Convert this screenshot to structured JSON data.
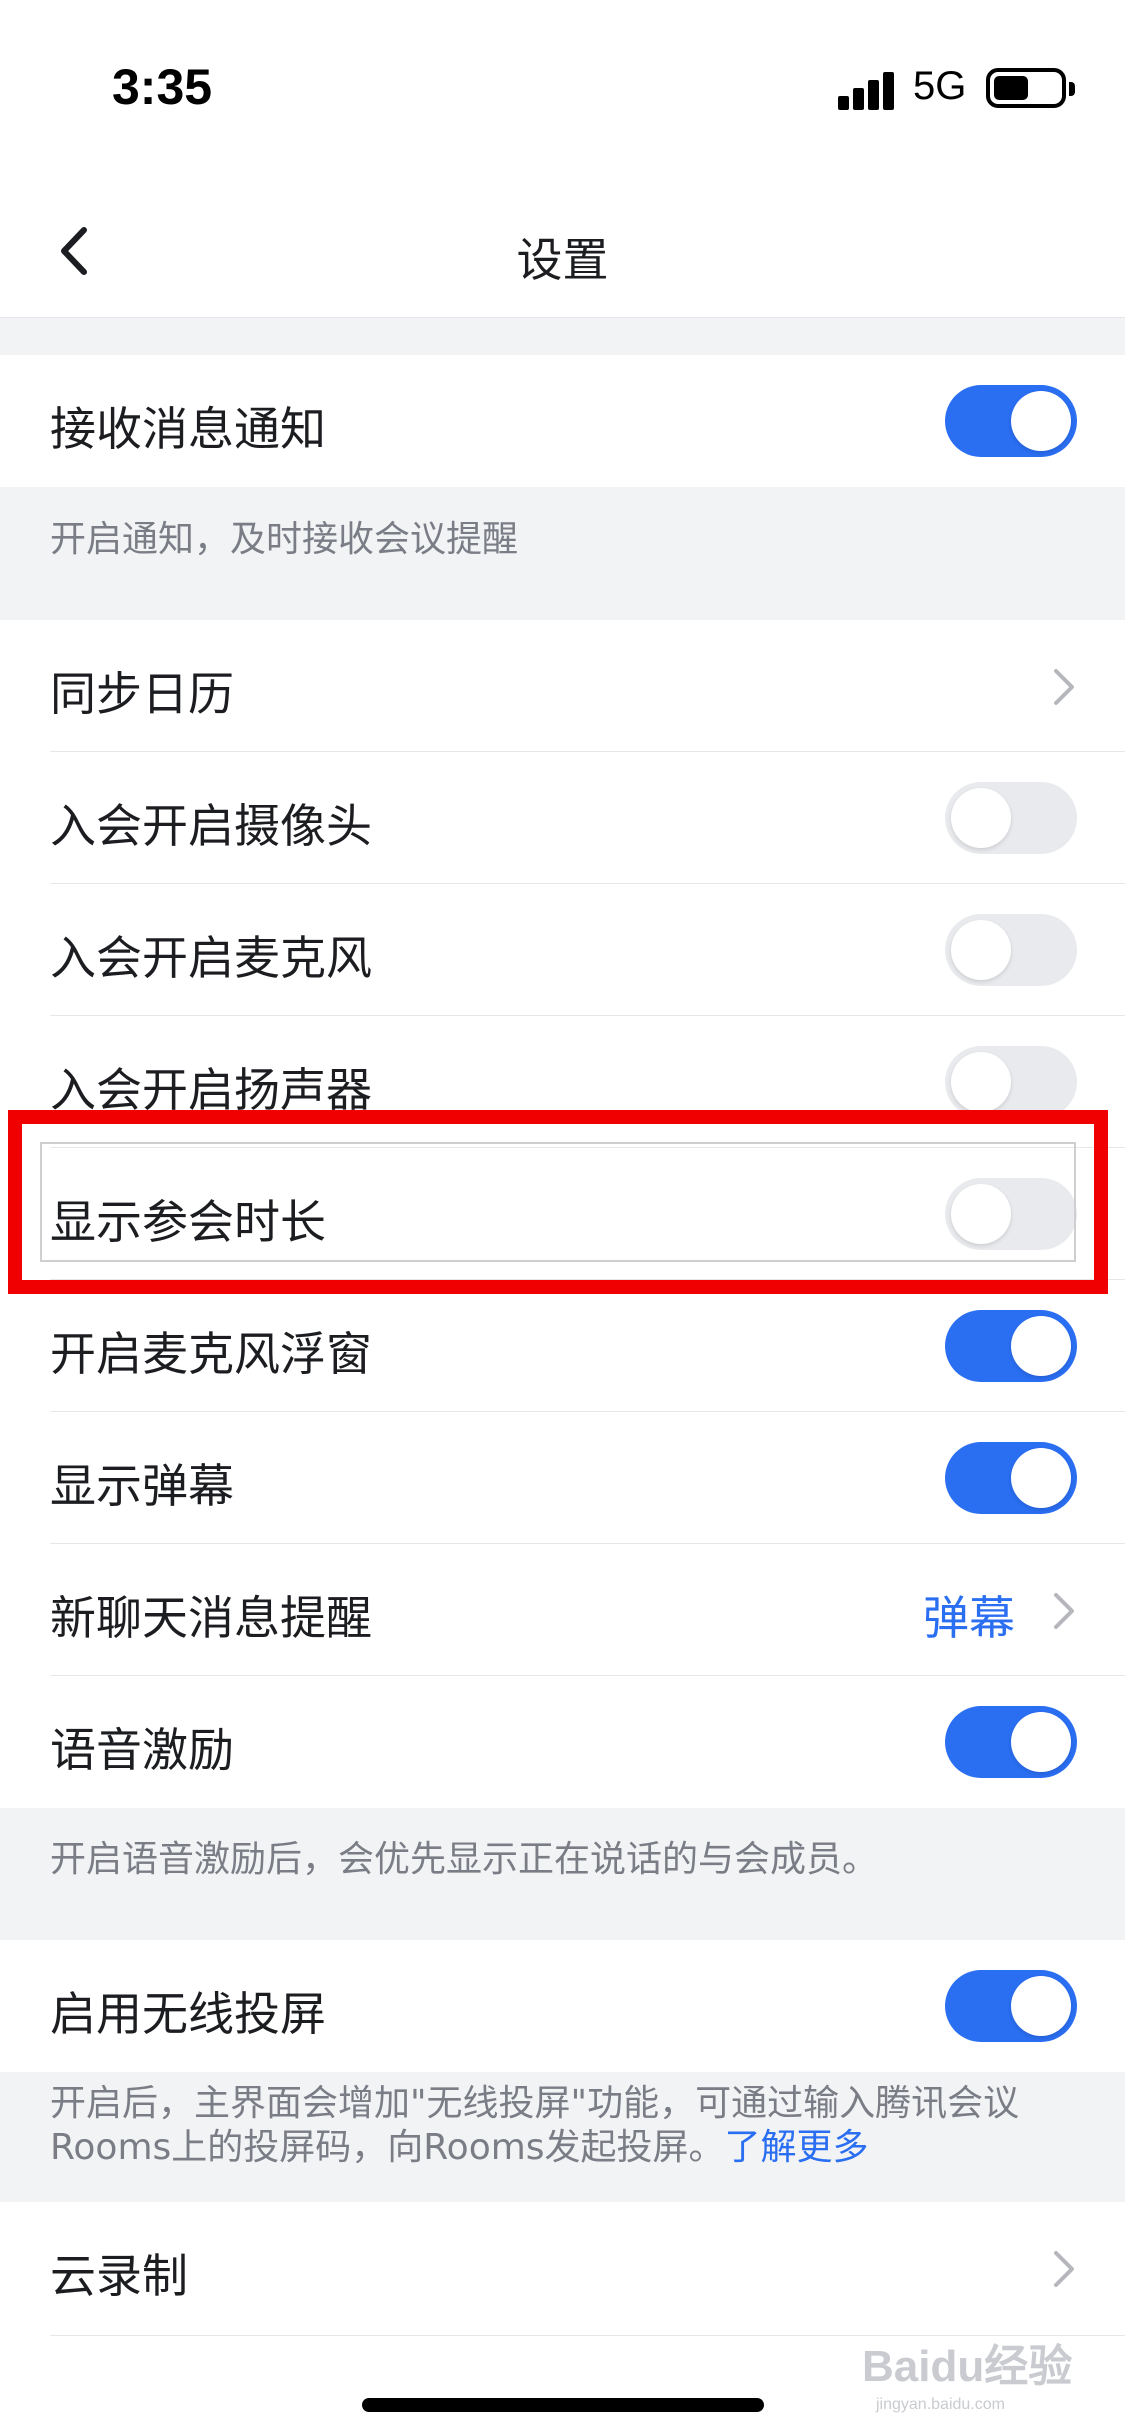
{
  "status_bar": {
    "time": "3:35",
    "network": "5G"
  },
  "nav": {
    "title": "设置"
  },
  "settings": {
    "notify": {
      "label": "接收消息通知",
      "on": true
    },
    "notify_note": "开启通知，及时接收会议提醒",
    "sync_calendar": {
      "label": "同步日历"
    },
    "camera": {
      "label": "入会开启摄像头",
      "on": false
    },
    "mic": {
      "label": "入会开启麦克风",
      "on": false
    },
    "speaker": {
      "label": "入会开启扬声器",
      "on": false
    },
    "duration": {
      "label": "显示参会时长",
      "on": false
    },
    "mic_float": {
      "label": "开启麦克风浮窗",
      "on": true
    },
    "danmaku": {
      "label": "显示弹幕",
      "on": true
    },
    "chat_remind": {
      "label": "新聊天消息提醒",
      "value": "弹幕"
    },
    "voice_excite": {
      "label": "语音激励",
      "on": true
    },
    "voice_note": "开启语音激励后，会优先显示正在说话的与会成员。",
    "wireless": {
      "label": "启用无线投屏",
      "on": true
    },
    "wireless_note_line1": "开启后，主界面会增加\"无线投屏\"功能，可通过输入腾讯会议",
    "wireless_note_line2": "Rooms上的投屏码，向Rooms发起投屏。",
    "wireless_note_link": "了解更多",
    "cloud_record": {
      "label": "云录制"
    }
  },
  "watermark": {
    "brand": "Baidu经验",
    "sub": "jingyan.baidu.com"
  },
  "colors": {
    "accent": "#2a6ef2",
    "highlight": "#f00000",
    "toggle_off": "#e9eaed"
  }
}
